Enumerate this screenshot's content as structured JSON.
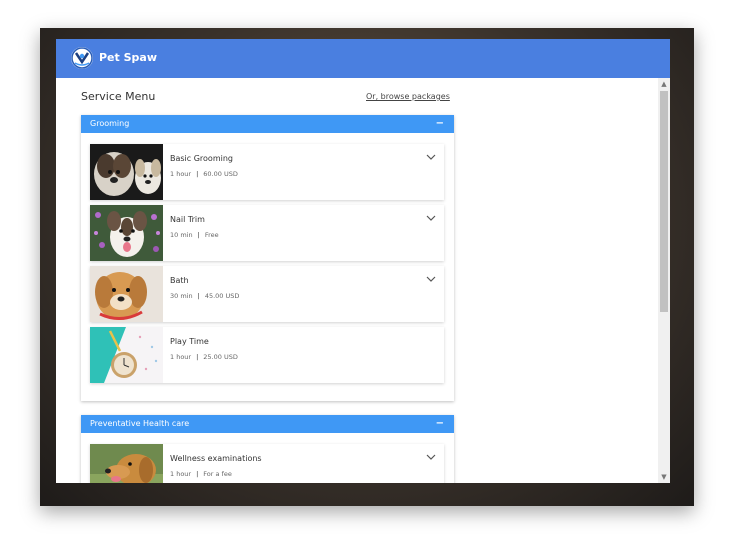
{
  "app": {
    "brand": "Pet Spaw"
  },
  "page": {
    "title": "Service Menu",
    "browse_link": "Or, browse packages"
  },
  "sections": [
    {
      "title": "Grooming",
      "collapse_symbol": "−",
      "services": [
        {
          "name": "Basic Grooming",
          "duration": "1 hour",
          "price": "60.00 USD"
        },
        {
          "name": "Nail Trim",
          "duration": "10 min",
          "price": "Free"
        },
        {
          "name": "Bath",
          "duration": "30 min",
          "price": "45.00 USD"
        },
        {
          "name": "Play Time",
          "duration": "1 hour",
          "price": "25.00 USD"
        }
      ]
    },
    {
      "title": "Preventative Health care",
      "collapse_symbol": "−",
      "services": [
        {
          "name": "Wellness examinations",
          "duration": "1 hour",
          "price": "For a fee"
        }
      ]
    }
  ],
  "meta_separator": "|",
  "scrollbar": {
    "up": "▲",
    "down": "▼"
  },
  "colors": {
    "header": "#4a7fe0",
    "section_head": "#3f98f5"
  }
}
